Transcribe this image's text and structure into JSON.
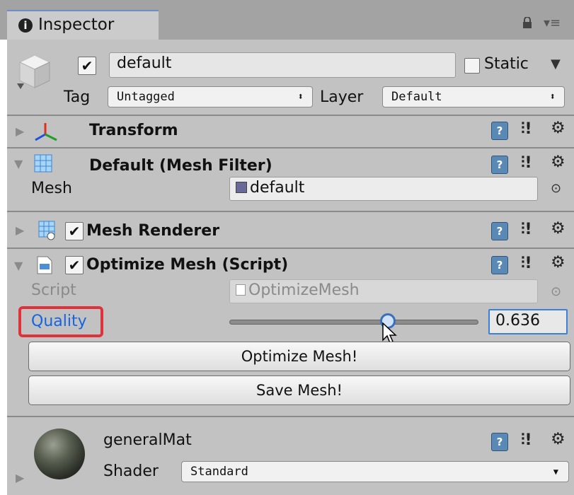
{
  "tab": {
    "icon": "info-icon",
    "title": "Inspector"
  },
  "header": {
    "active": true,
    "name": "default",
    "static_label": "Static",
    "tag_label": "Tag",
    "tag_value": "Untagged",
    "layer_label": "Layer",
    "layer_value": "Default"
  },
  "components": {
    "transform": {
      "title": "Transform"
    },
    "mesh_filter": {
      "title": "Default (Mesh Filter)",
      "mesh_label": "Mesh",
      "mesh_value": "default"
    },
    "mesh_renderer": {
      "title": "Mesh Renderer",
      "enabled": true
    },
    "optimize_mesh": {
      "title": "Optimize Mesh (Script)",
      "enabled": true,
      "script_label": "Script",
      "script_value": "OptimizeMesh",
      "quality_label": "Quality",
      "quality_value": "0.636",
      "quality_fraction": 0.636,
      "optimize_button": "Optimize Mesh!",
      "save_button": "Save Mesh!"
    }
  },
  "material": {
    "name": "generalMat",
    "shader_label": "Shader",
    "shader_value": "Standard"
  },
  "colors": {
    "highlight_box": "#e0323b",
    "accent_blue": "#1565e0",
    "panel": "#c2c2c2"
  }
}
